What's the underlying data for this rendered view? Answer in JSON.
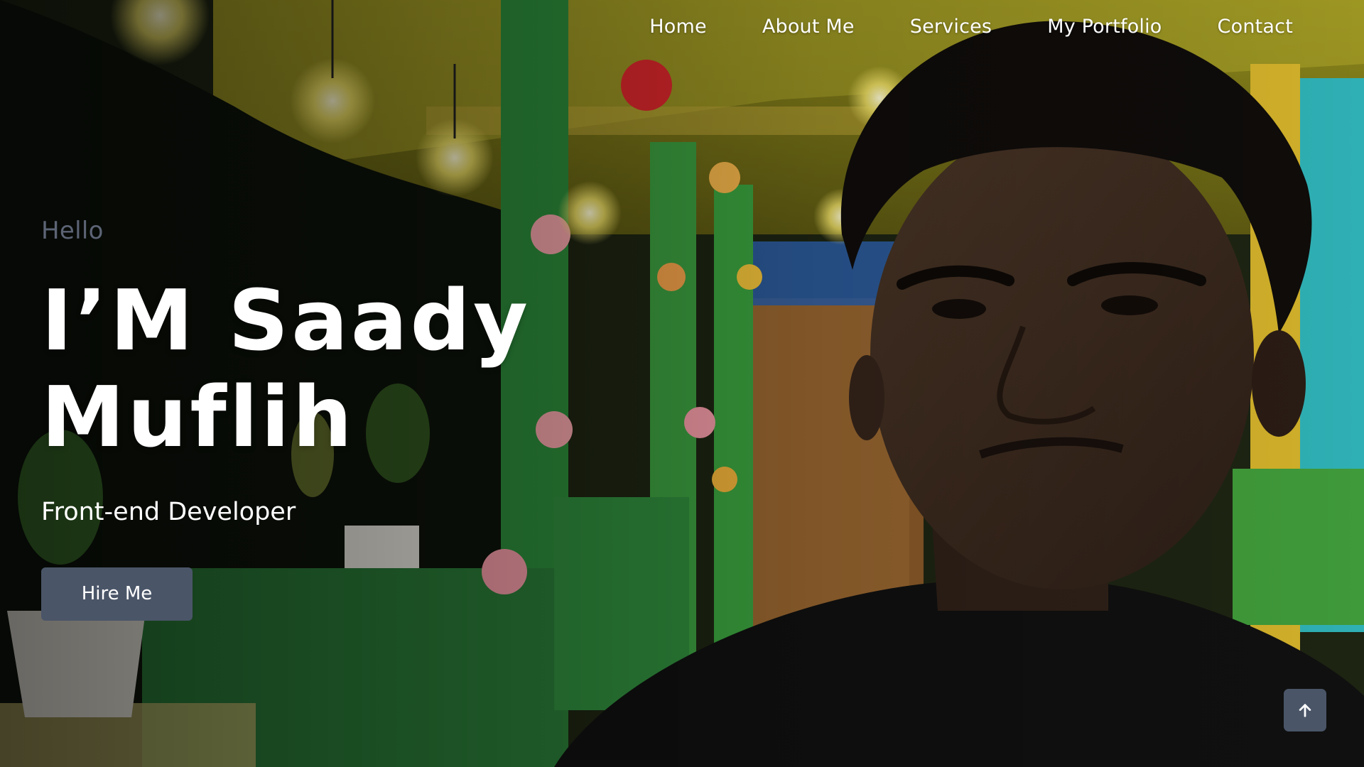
{
  "nav": {
    "items": [
      {
        "label": "Home"
      },
      {
        "label": "About Me"
      },
      {
        "label": "Services"
      },
      {
        "label": "My Portfolio"
      },
      {
        "label": "Contact"
      }
    ]
  },
  "hero": {
    "greeting": "Hello",
    "name_line1": "I’M Saady",
    "name_line2": "Muflih",
    "role": "Front-end Developer",
    "cta_label": "Hire Me",
    "background_image": "hero-portrait-photo"
  },
  "scroll_top": {
    "icon": "arrow-up-icon"
  },
  "colors": {
    "accent": "#4a5568",
    "greeting_text": "#5c6475",
    "text": "#ffffff"
  }
}
